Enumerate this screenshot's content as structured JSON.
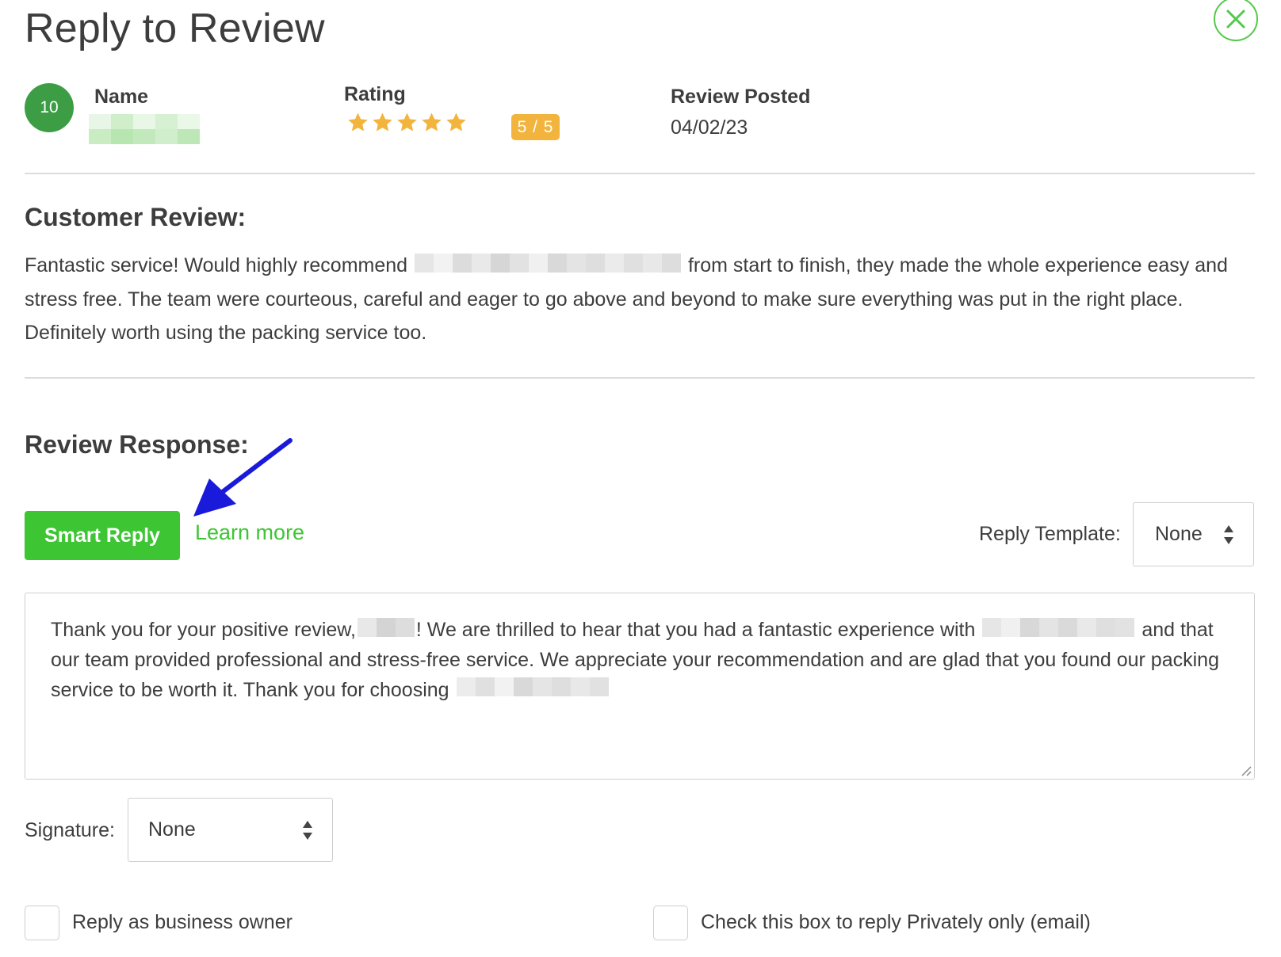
{
  "dialog": {
    "title": "Reply to Review",
    "close_icon": "close-circle-icon"
  },
  "reviewer": {
    "avatar_count": "10",
    "name_label": "Name",
    "rating_label": "Rating",
    "rating_stars": 5,
    "rating_badge": "5 / 5",
    "posted_label": "Review Posted",
    "posted_date": "04/02/23"
  },
  "customer_review": {
    "heading": "Customer Review:",
    "text_before": "Fantastic service! Would highly recommend",
    "text_after": "from start to finish, they made the whole experience easy and stress free. The team were courteous, careful and eager to go above and beyond to make sure everything was put in the right place. Definitely worth using the packing service too."
  },
  "response": {
    "heading": "Review Response:",
    "smart_reply_label": "Smart Reply",
    "learn_more_label": "Learn more",
    "template_label": "Reply Template:",
    "template_value": "None",
    "reply_part1": "Thank you for your positive review,",
    "reply_part2": "! We are thrilled to hear that you had a fantastic experience with",
    "reply_part3": "and that our team provided professional and stress-free service. We appreciate your recommendation and are glad that you found our packing service to be worth it. Thank you for choosing",
    "signature_label": "Signature:",
    "signature_value": "None"
  },
  "options": {
    "owner_checkbox_label": "Reply as business owner",
    "owner_checked": false,
    "private_checkbox_label": "Check this box to reply Privately only (email)",
    "private_checked": false
  },
  "colors": {
    "accent_green": "#3ec534",
    "avatar_green": "#3d9d45",
    "star_gold": "#f2b43c",
    "annotation_arrow": "#1a1adb"
  }
}
